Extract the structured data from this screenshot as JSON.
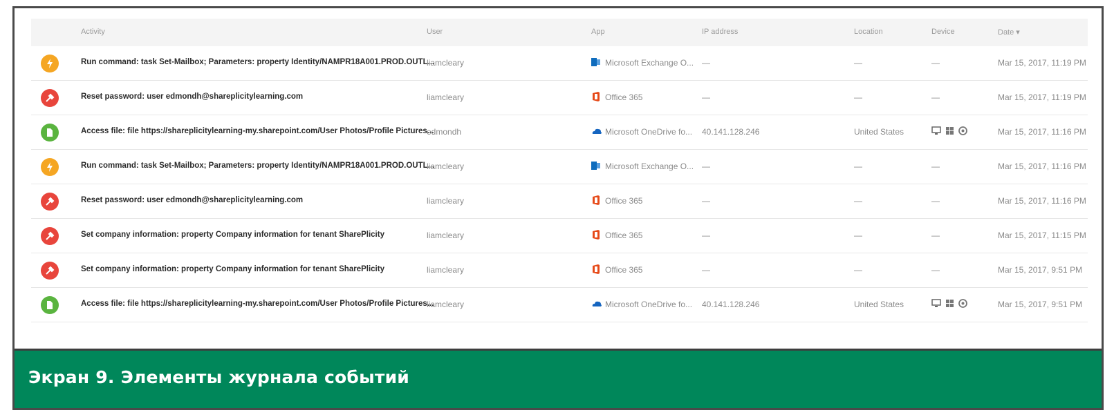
{
  "headers": {
    "activity": "Activity",
    "user": "User",
    "app": "App",
    "ip": "IP address",
    "location": "Location",
    "device": "Device",
    "date": "Date ▾"
  },
  "rows": [
    {
      "status": "orange",
      "activity": "Run command: task Set-Mailbox; Parameters: property Identity/NAMPR18A001.PROD.OUTL...",
      "user": "liamcleary",
      "app_icon": "exchange",
      "app": "Microsoft Exchange O...",
      "ip": "—",
      "location": "—",
      "device": "—",
      "date": "Mar 15, 2017, 11:19 PM"
    },
    {
      "status": "red",
      "activity": "Reset password: user edmondh@shareplicitylearning.com",
      "user": "liamcleary",
      "app_icon": "office",
      "app": "Office 365",
      "ip": "—",
      "location": "—",
      "device": "—",
      "date": "Mar 15, 2017, 11:19 PM"
    },
    {
      "status": "green",
      "activity": "Access file: file https://shareplicitylearning-my.sharepoint.com/User Photos/Profile Pictures...",
      "user": "edmondh",
      "app_icon": "onedrive",
      "app": "Microsoft OneDrive fo...",
      "ip": "40.141.128.246",
      "location": "United States",
      "device": "icons",
      "date": "Mar 15, 2017, 11:16 PM"
    },
    {
      "status": "orange",
      "activity": "Run command: task Set-Mailbox; Parameters: property Identity/NAMPR18A001.PROD.OUTL...",
      "user": "liamcleary",
      "app_icon": "exchange",
      "app": "Microsoft Exchange O...",
      "ip": "—",
      "location": "—",
      "device": "—",
      "date": "Mar 15, 2017, 11:16 PM"
    },
    {
      "status": "red",
      "activity": "Reset password: user edmondh@shareplicitylearning.com",
      "user": "liamcleary",
      "app_icon": "office",
      "app": "Office 365",
      "ip": "—",
      "location": "—",
      "device": "—",
      "date": "Mar 15, 2017, 11:16 PM"
    },
    {
      "status": "red",
      "activity": "Set company information: property Company information for tenant SharePlicity",
      "user": "liamcleary",
      "app_icon": "office",
      "app": "Office 365",
      "ip": "—",
      "location": "—",
      "device": "—",
      "date": "Mar 15, 2017, 11:15 PM"
    },
    {
      "status": "red",
      "activity": "Set company information: property Company information for tenant SharePlicity",
      "user": "liamcleary",
      "app_icon": "office",
      "app": "Office 365",
      "ip": "—",
      "location": "—",
      "device": "—",
      "date": "Mar 15, 2017, 9:51 PM"
    },
    {
      "status": "green",
      "activity": "Access file: file https://shareplicitylearning-my.sharepoint.com/User Photos/Profile Pictures...",
      "user": "liamcleary",
      "app_icon": "onedrive",
      "app": "Microsoft OneDrive fo...",
      "ip": "40.141.128.246",
      "location": "United States",
      "device": "icons",
      "date": "Mar 15, 2017, 9:51 PM"
    }
  ],
  "caption": "Экран 9. Элементы журнала событий",
  "colors": {
    "accent": "#00875a",
    "orange": "#f5a623",
    "red": "#e8453c",
    "green": "#5ab43f"
  }
}
